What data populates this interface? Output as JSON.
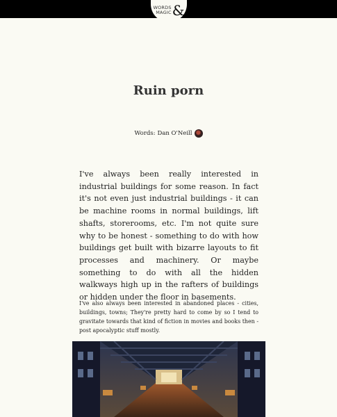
{
  "header": {
    "logo_line1": "WORDS",
    "logo_line2": "MAGIC",
    "logo_amp": "&"
  },
  "article": {
    "title": "Ruin porn",
    "byline_prefix": "Words:",
    "author": "Dan O'Neill",
    "paragraph_1": "I've always been really interested in industrial buildings for some reason. In fact it's not even just industrial buildings - it can be machine rooms in normal buildings, lift shafts, storerooms, etc. I'm not quite sure why to be honest - something to do with how buildings get built with bizarre layouts to fit processes and machinery. Or maybe something to do with all the hidden walkways high up in the rafters of buildings or hidden under the floor in basements.",
    "paragraph_2": "I've also always been interested in abandoned places - cities, buildings, towns; They're pretty hard to come by so I tend to gravitate towards that kind of fiction in movies and books then - post apocalyptic stuff mostly."
  }
}
